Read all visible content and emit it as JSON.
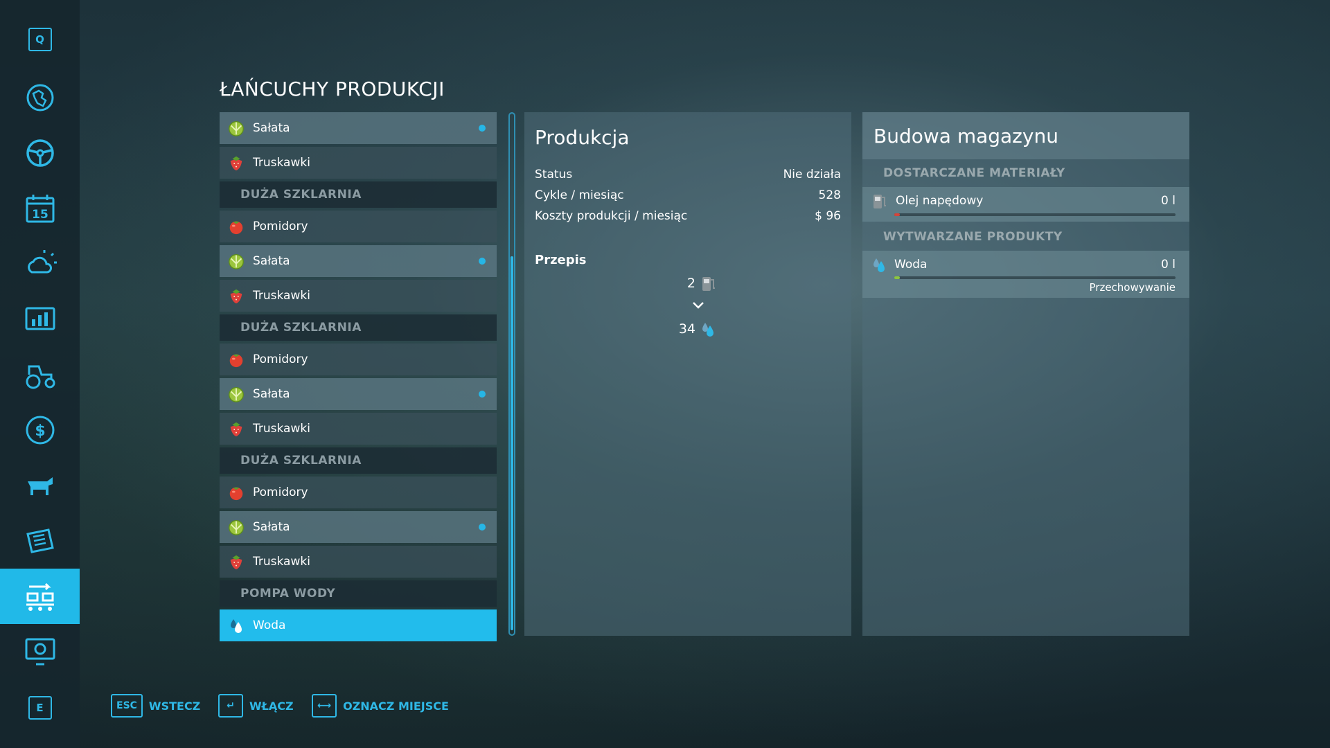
{
  "colors": {
    "accent": "#22bcec",
    "bg": "#1d323a",
    "muted": "#8b9ba2",
    "fuel_bar": "#d4453b",
    "water_bar": "#8cc63f"
  },
  "sidebar": {
    "top_key": "Q",
    "bottom_key": "E",
    "items": [
      {
        "name": "map-icon"
      },
      {
        "name": "steering-wheel-icon"
      },
      {
        "name": "calendar-icon",
        "text": "15"
      },
      {
        "name": "weather-icon"
      },
      {
        "name": "statistics-icon"
      },
      {
        "name": "tractor-icon"
      },
      {
        "name": "finance-icon"
      },
      {
        "name": "animals-icon"
      },
      {
        "name": "contracts-icon"
      },
      {
        "name": "production-icon",
        "active": true
      },
      {
        "name": "help-icon"
      }
    ]
  },
  "title": "ŁAŃCUCHY PRODUKCJI",
  "list": [
    {
      "type": "item",
      "label": "Sałata",
      "icon": "lettuce",
      "selected": true,
      "dot": true
    },
    {
      "type": "item",
      "label": "Truskawki",
      "icon": "strawberry"
    },
    {
      "type": "group",
      "label": "DUŻA SZKLARNIA"
    },
    {
      "type": "item",
      "label": "Pomidory",
      "icon": "tomato"
    },
    {
      "type": "item",
      "label": "Sałata",
      "icon": "lettuce",
      "selected": true,
      "dot": true
    },
    {
      "type": "item",
      "label": "Truskawki",
      "icon": "strawberry"
    },
    {
      "type": "group",
      "label": "DUŻA SZKLARNIA"
    },
    {
      "type": "item",
      "label": "Pomidory",
      "icon": "tomato"
    },
    {
      "type": "item",
      "label": "Sałata",
      "icon": "lettuce",
      "selected": true,
      "dot": true
    },
    {
      "type": "item",
      "label": "Truskawki",
      "icon": "strawberry"
    },
    {
      "type": "group",
      "label": "DUŻA SZKLARNIA"
    },
    {
      "type": "item",
      "label": "Pomidory",
      "icon": "tomato"
    },
    {
      "type": "item",
      "label": "Sałata",
      "icon": "lettuce",
      "selected": true,
      "dot": true
    },
    {
      "type": "item",
      "label": "Truskawki",
      "icon": "strawberry"
    },
    {
      "type": "group",
      "label": "POMPA WODY"
    },
    {
      "type": "item",
      "label": "Woda",
      "icon": "water",
      "active": true
    }
  ],
  "production": {
    "title": "Produkcja",
    "status_label": "Status",
    "status_value": "Nie działa",
    "cycles_label": "Cykle / miesiąc",
    "cycles_value": "528",
    "costs_label": "Koszty produkcji / miesiąc",
    "costs_value": "$ 96",
    "recipe_title": "Przepis",
    "recipe_input_amount": "2",
    "recipe_input_icon": "fuel-pump-icon",
    "recipe_output_amount": "34",
    "recipe_output_icon": "water-drop-icon"
  },
  "storage": {
    "title": "Budowa magazynu",
    "supplied_header": "DOSTARCZANE MATERIAŁY",
    "supplied": [
      {
        "name": "Olej napędowy",
        "value": "0 l",
        "icon": "fuel-pump-icon",
        "fill": 0.0
      }
    ],
    "produced_header": "WYTWARZANE PRODUKTY",
    "produced": [
      {
        "name": "Woda",
        "value": "0 l",
        "icon": "water-drop-icon",
        "mode": "Przechowywanie",
        "fill": 0.0
      }
    ]
  },
  "bottom_bar": [
    {
      "key": "ESC",
      "label": "WSTECZ"
    },
    {
      "key": "↵",
      "label": "WŁĄCZ"
    },
    {
      "key": "⟷",
      "label": "OZNACZ MIEJSCE"
    }
  ]
}
